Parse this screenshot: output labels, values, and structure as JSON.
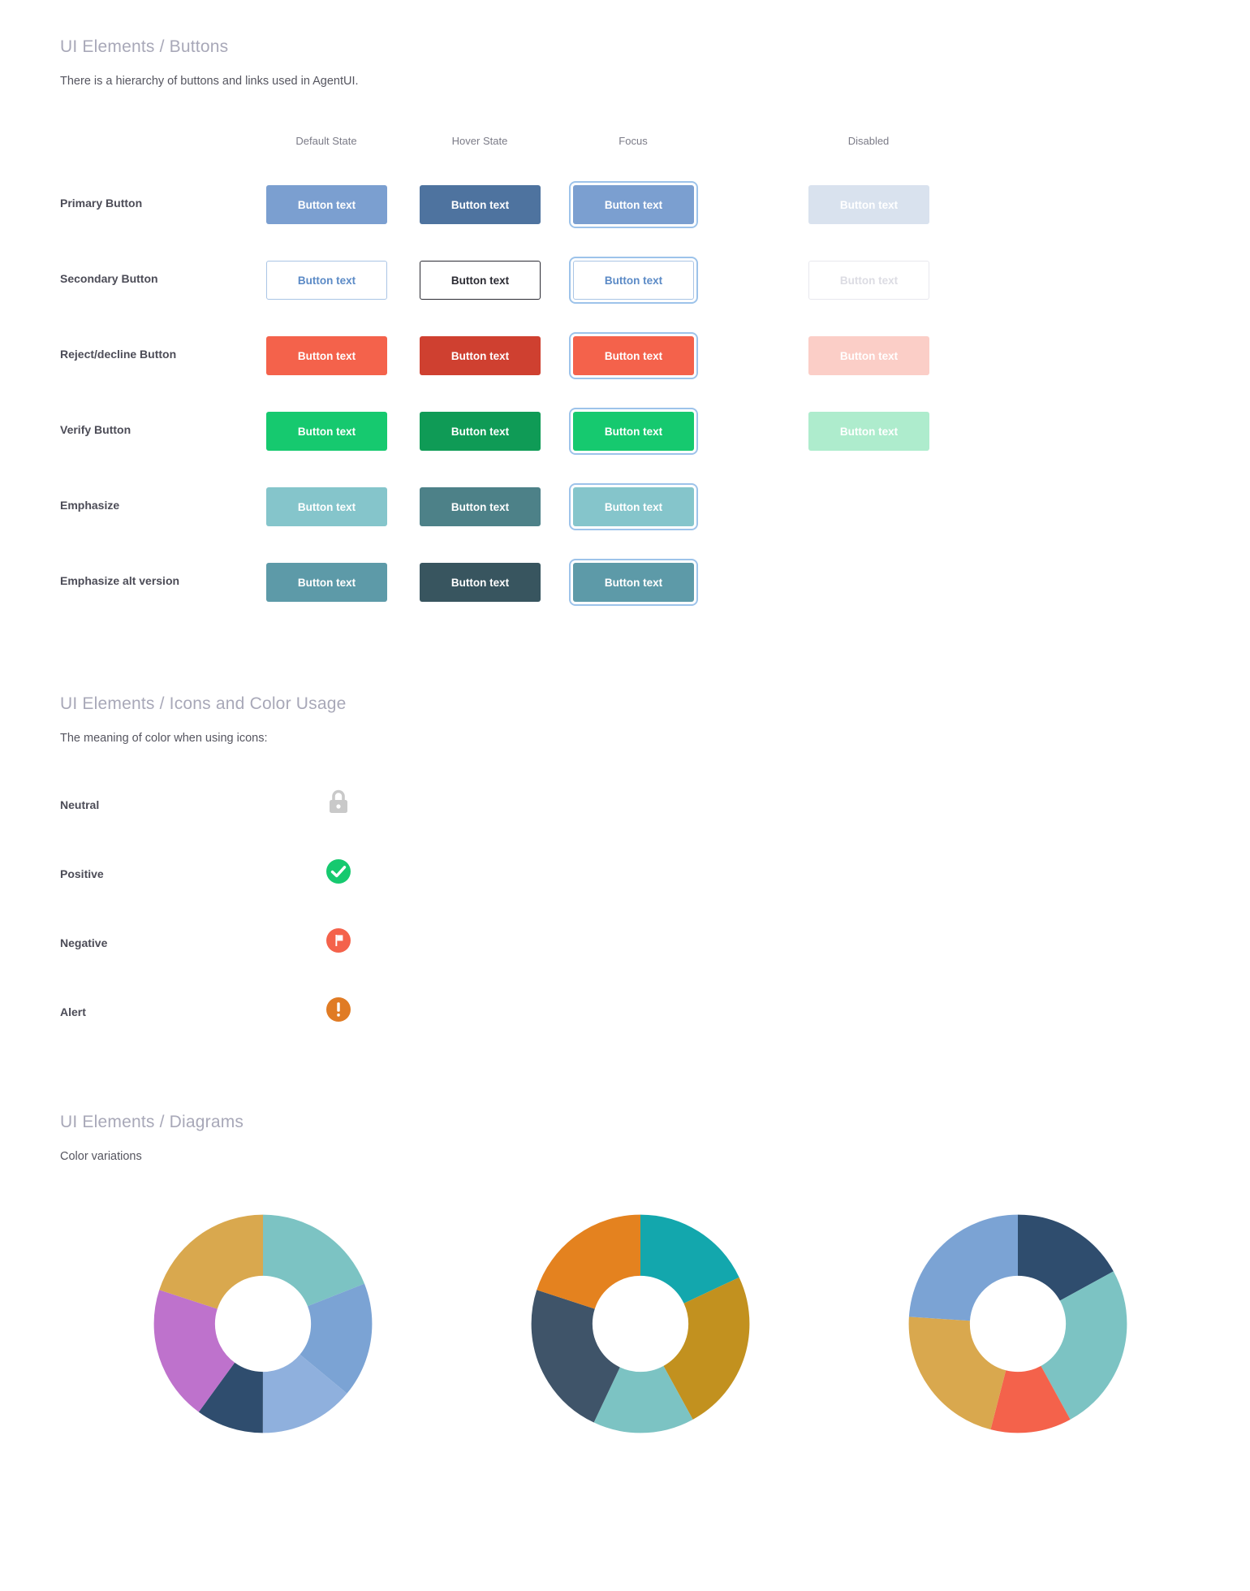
{
  "sections": {
    "buttons": {
      "title": "UI Elements / Buttons",
      "subtitle": "There is a hierarchy of buttons and links used in AgentUI.",
      "column_headers": [
        "Default State",
        "Hover State",
        "Focus",
        "Disabled"
      ],
      "button_label": "Button text",
      "rows": [
        {
          "label": "Primary Button",
          "states": [
            {
              "state": "default",
              "bg": "#7b9fd0",
              "fg": "#ffffff",
              "border": "none",
              "focus": false,
              "present": true
            },
            {
              "state": "hover",
              "bg": "#4e739f",
              "fg": "#ffffff",
              "border": "none",
              "focus": false,
              "present": true
            },
            {
              "state": "focus",
              "bg": "#7b9fd0",
              "fg": "#ffffff",
              "border": "none",
              "focus": true,
              "present": true
            },
            {
              "state": "disabled",
              "bg": "#d9e2ee",
              "fg": "#ffffff",
              "border": "none",
              "focus": false,
              "present": true
            }
          ]
        },
        {
          "label": "Secondary Button",
          "states": [
            {
              "state": "default",
              "bg": "#ffffff",
              "fg": "#5b8ac6",
              "border": "#aac5e5",
              "focus": false,
              "present": true
            },
            {
              "state": "hover",
              "bg": "#ffffff",
              "fg": "#2b2b33",
              "border": "#2b2b33",
              "focus": false,
              "present": true
            },
            {
              "state": "focus",
              "bg": "#ffffff",
              "fg": "#5b8ac6",
              "border": "#aac5e5",
              "focus": true,
              "present": true
            },
            {
              "state": "disabled",
              "bg": "#ffffff",
              "fg": "#dcdce3",
              "border": "#e8e8ee",
              "focus": false,
              "present": true
            }
          ]
        },
        {
          "label": "Reject/decline Button",
          "states": [
            {
              "state": "default",
              "bg": "#f4624b",
              "fg": "#ffffff",
              "border": "none",
              "focus": false,
              "present": true
            },
            {
              "state": "hover",
              "bg": "#cf4030",
              "fg": "#ffffff",
              "border": "none",
              "focus": false,
              "present": true
            },
            {
              "state": "focus",
              "bg": "#f4624b",
              "fg": "#ffffff",
              "border": "none",
              "focus": true,
              "present": true
            },
            {
              "state": "disabled",
              "bg": "#fbcec7",
              "fg": "#ffffff",
              "border": "none",
              "focus": false,
              "present": true
            }
          ]
        },
        {
          "label": "Verify Button",
          "states": [
            {
              "state": "default",
              "bg": "#16c96f",
              "fg": "#ffffff",
              "border": "none",
              "focus": false,
              "present": true
            },
            {
              "state": "hover",
              "bg": "#0f9b56",
              "fg": "#ffffff",
              "border": "none",
              "focus": false,
              "present": true
            },
            {
              "state": "focus",
              "bg": "#16c96f",
              "fg": "#ffffff",
              "border": "none",
              "focus": true,
              "present": true
            },
            {
              "state": "disabled",
              "bg": "#aeeccd",
              "fg": "#ffffff",
              "border": "none",
              "focus": false,
              "present": true
            }
          ]
        },
        {
          "label": "Emphasize",
          "states": [
            {
              "state": "default",
              "bg": "#85c5cb",
              "fg": "#ffffff",
              "border": "none",
              "focus": false,
              "present": true
            },
            {
              "state": "hover",
              "bg": "#4d8188",
              "fg": "#ffffff",
              "border": "none",
              "focus": false,
              "present": true
            },
            {
              "state": "focus",
              "bg": "#85c5cb",
              "fg": "#ffffff",
              "border": "none",
              "focus": true,
              "present": true
            },
            {
              "state": "disabled",
              "bg": "",
              "fg": "",
              "border": "none",
              "focus": false,
              "present": false
            }
          ]
        },
        {
          "label": "Emphasize alt version",
          "states": [
            {
              "state": "default",
              "bg": "#5d9aa8",
              "fg": "#ffffff",
              "border": "none",
              "focus": false,
              "present": true
            },
            {
              "state": "hover",
              "bg": "#38555f",
              "fg": "#ffffff",
              "border": "none",
              "focus": false,
              "present": true
            },
            {
              "state": "focus",
              "bg": "#5d9aa8",
              "fg": "#ffffff",
              "border": "none",
              "focus": true,
              "present": true
            },
            {
              "state": "disabled",
              "bg": "",
              "fg": "",
              "border": "none",
              "focus": false,
              "present": false
            }
          ]
        }
      ]
    },
    "icons": {
      "title": "UI Elements / Icons and Color Usage",
      "subtitle": "The meaning of color when using icons:",
      "rows": [
        {
          "label": "Neutral",
          "icon": "lock-icon",
          "color": "#c9c9c9"
        },
        {
          "label": "Positive",
          "icon": "check-circle-icon",
          "color": "#16c96f"
        },
        {
          "label": "Negative",
          "icon": "flag-circle-icon",
          "color": "#f4624b"
        },
        {
          "label": "Alert",
          "icon": "alert-circle-icon",
          "color": "#e07b24"
        }
      ]
    },
    "diagrams": {
      "title": "UI Elements / Diagrams",
      "subtitle": "Color variations"
    }
  },
  "chart_data": [
    {
      "type": "pie",
      "title": "Color variations donut 1",
      "variant": "donut",
      "hole_ratio": 0.72,
      "start_angle": 0,
      "categories": [
        "Teal",
        "Light blue",
        "Pale blue",
        "Navy",
        "Orchid",
        "Gold"
      ],
      "values": [
        19,
        17,
        14,
        10,
        20,
        20
      ],
      "colors": [
        "#7cc3c3",
        "#7ba3d4",
        "#8fb0dd",
        "#2f4d6e",
        "#be72cc",
        "#d9a84e"
      ],
      "legend": "none"
    },
    {
      "type": "pie",
      "title": "Color variations donut 2",
      "variant": "donut",
      "hole_ratio": 0.72,
      "start_angle": 0,
      "categories": [
        "Teal",
        "Goldenrod",
        "Light teal",
        "Slate",
        "Orange"
      ],
      "values": [
        18,
        24,
        15,
        23,
        20
      ],
      "colors": [
        "#13a7ad",
        "#c2911f",
        "#7cc3c3",
        "#3f5469",
        "#e4821f"
      ],
      "legend": "none"
    },
    {
      "type": "pie",
      "title": "Color variations donut 3",
      "variant": "donut",
      "hole_ratio": 0.72,
      "start_angle": 0,
      "categories": [
        "Navy",
        "Light teal",
        "Coral",
        "Gold",
        "Steel blue"
      ],
      "values": [
        17,
        25,
        12,
        22,
        24
      ],
      "colors": [
        "#2f4d6e",
        "#7cc3c3",
        "#f4624b",
        "#d9a84e",
        "#7ba3d4"
      ],
      "legend": "none"
    }
  ]
}
